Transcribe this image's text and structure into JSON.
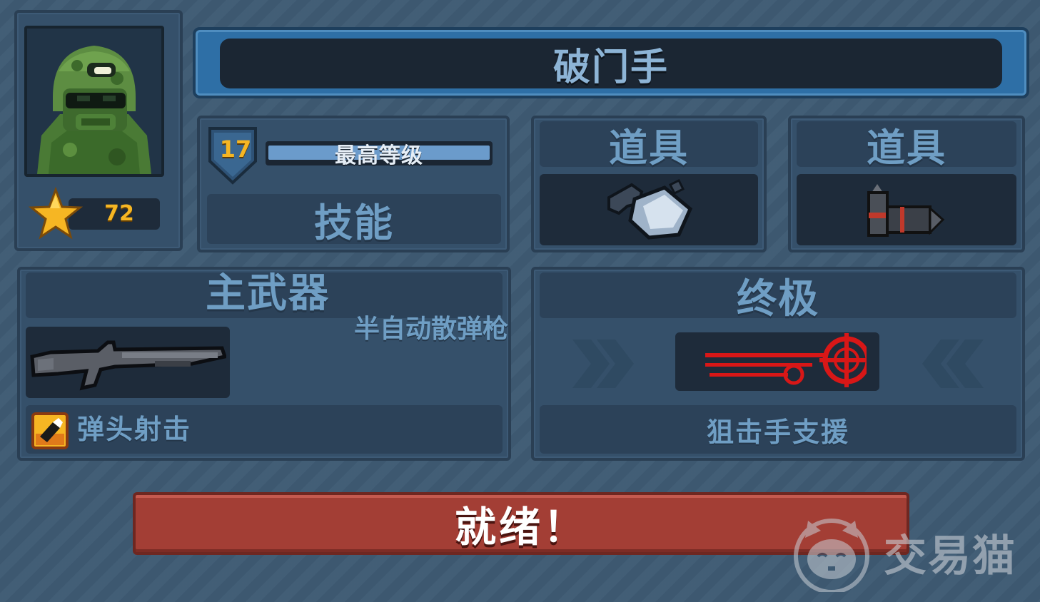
{
  "character": {
    "name": "破门手",
    "level": "17",
    "level_status": "最高等级",
    "star_count": "72",
    "portrait_icon": "soldier-helmet-portrait",
    "star_icon": "gold-star-icon"
  },
  "skills": {
    "label": "技能"
  },
  "items": [
    {
      "label": "道具",
      "icon": "ballistic-shield-icon"
    },
    {
      "label": "道具",
      "icon": "ammo-belt-icon"
    }
  ],
  "primary_weapon": {
    "label": "主武器",
    "weapon_type": "半自动散弹枪",
    "weapon_icon": "shotgun-icon",
    "perk_label": "弹头射击",
    "perk_icon": "bullet-perk-icon"
  },
  "ultimate": {
    "label": "终极",
    "ability_name": "狙击手支援",
    "icon": "sniper-crosshair-icon",
    "left_arrow_icon": "chevron-right-icon",
    "right_arrow_icon": "chevron-left-icon"
  },
  "ready_button": {
    "label": "就绪！",
    "color": "#a33e35"
  },
  "watermark": {
    "text": "交易猫",
    "icon": "cat-logo-icon"
  },
  "colors": {
    "panel": "#35506a",
    "dark_slot": "#1e2b3a",
    "text": "#6f9ec4",
    "gold": "#f6b623",
    "accent_red": "#d81717"
  }
}
